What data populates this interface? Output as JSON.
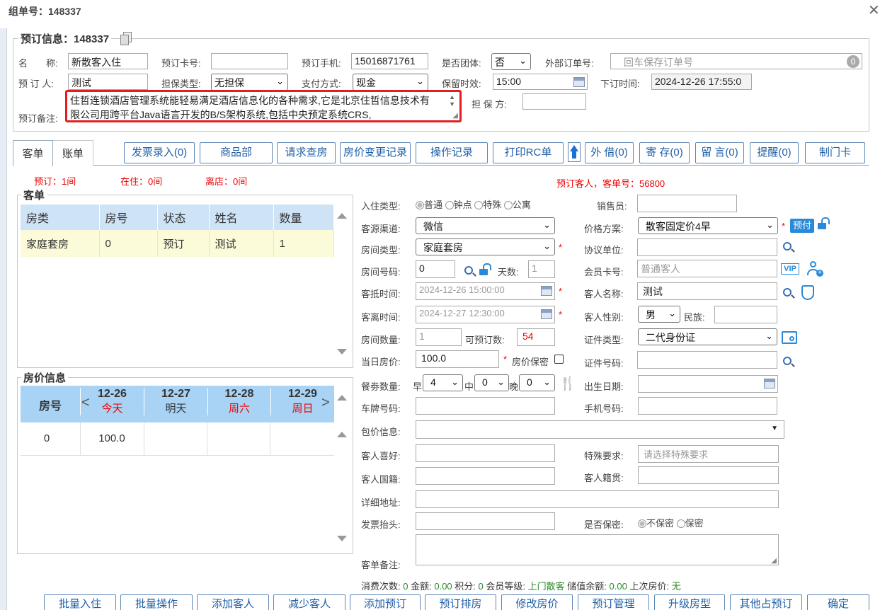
{
  "window": {
    "title": "组单号：148337"
  },
  "booking": {
    "legend": "预订信息：148337",
    "name_label": "名　　称:",
    "name_value": "新散客入住",
    "card_label": "预订卡号:",
    "card_value": "",
    "phone_label": "预订手机:",
    "phone_value": "15016871761",
    "group_label": "是否团体:",
    "group_value": "否",
    "external_label": "外部订单号:",
    "external_placeholder": "回车保存订单号",
    "external_badge": "0",
    "booker_label": "预 订 人:",
    "booker_value": "测试",
    "guarantee_type_label": "担保类型:",
    "guarantee_type_value": "无担保",
    "pay_label": "支付方式:",
    "pay_value": "现金",
    "retain_label": "保留时效:",
    "retain_value": "15:00",
    "order_time_label": "下订时间:",
    "order_time_value": "2024-12-26 17:55:0",
    "remark_label": "预订备注:",
    "remark_value": "住哲连锁酒店管理系统能轻易满足酒店信息化的各种需求,它是北京住哲信息技术有限公司用跨平台Java语言开发的B/S架构系统,包括中央预定系统CRS,",
    "guarantor_label": "担 保 方:",
    "guarantor_value": ""
  },
  "tabs": [
    "客单",
    "账单"
  ],
  "toolbar": {
    "invoice": "发票录入(0)",
    "goods": "商品部",
    "housekeeping": "请求查房",
    "price_log": "房价变更记录",
    "op_log": "操作记录",
    "print_rc": "打印RC单",
    "borrow": "外 借(0)",
    "deposit": "寄 存(0)",
    "message": "留 言(0)",
    "reminder": "提醒(0)",
    "make_card": "制门卡"
  },
  "status": {
    "reserved": "预订：1间",
    "in_house": "在住：0间",
    "departed": "离店：0间",
    "guest_info": "预订客人，客单号：56800"
  },
  "guest_list": {
    "legend": "客单",
    "columns": [
      "房类",
      "房号",
      "状态",
      "姓名",
      "数量"
    ],
    "rows": [
      [
        "家庭套房",
        "0",
        "预订",
        "测试",
        "1"
      ]
    ]
  },
  "price_info": {
    "legend": "房价信息",
    "room_col": "房号",
    "dates": [
      {
        "d": "12-26",
        "w": "今天"
      },
      {
        "d": "12-27",
        "w": "明天"
      },
      {
        "d": "12-28",
        "w": "周六"
      },
      {
        "d": "12-29",
        "w": "周日"
      }
    ],
    "row": {
      "room": "0",
      "p1": "100.0"
    }
  },
  "form": {
    "checkin_type_label": "入住类型:",
    "checkin_types": [
      "普通",
      "钟点",
      "特殊",
      "公寓"
    ],
    "sales_label": "销售员:",
    "source_label": "客源渠道:",
    "source_value": "微信",
    "price_plan_label": "价格方案:",
    "price_plan_value": "散客固定价4早",
    "prepay": "预付",
    "room_type_label": "房间类型:",
    "room_type_value": "家庭套房",
    "agreement_label": "协议单位:",
    "room_no_label": "房间号码:",
    "room_no_value": "0",
    "days_label": "天数:",
    "days_value": "1",
    "member_label": "会员卡号:",
    "member_placeholder": "普通客人",
    "vip": "VIP",
    "arrive_label": "客抵时间:",
    "arrive_value": "2024-12-26 15:00:00",
    "guest_name_label": "客人名称:",
    "guest_name_value": "测试",
    "depart_label": "客离时间:",
    "depart_value": "2024-12-27 12:30:00",
    "gender_label": "客人性别:",
    "gender_value": "男",
    "ethnic_label": "民族:",
    "room_count_label": "房间数量:",
    "room_count_value": "1",
    "avail_label": "可预订数:",
    "avail_value": "54",
    "id_type_label": "证件类型:",
    "id_type_value": "二代身份证",
    "day_price_label": "当日房价:",
    "day_price_value": "100.0",
    "price_secret_label": "房价保密",
    "id_no_label": "证件号码:",
    "meal_label": "餐劵数量:",
    "breakfast_label": "早",
    "breakfast_value": "4",
    "lunch_label": "中",
    "lunch_value": "0",
    "dinner_label": "晚",
    "dinner_value": "0",
    "birth_label": "出生日期:",
    "plate_label": "车牌号码:",
    "mobile_label": "手机号码:",
    "package_label": "包价信息:",
    "hobby_label": "客人喜好:",
    "special_label": "特殊要求:",
    "special_placeholder": "请选择特殊要求",
    "nationality_label": "客人国籍:",
    "native_label": "客人籍贯:",
    "address_label": "详细地址:",
    "invoice_title_label": "发票抬头:",
    "secret_label": "是否保密:",
    "secret_options": [
      "不保密",
      "保密"
    ],
    "guest_remark_label": "客单备注:"
  },
  "summary": {
    "consume_label": "消费次数:",
    "consume": "0",
    "amount_label": "金额:",
    "amount": "0.00",
    "points_label": "积分:",
    "points": "0",
    "level_label": "会员等级:",
    "level": "上门散客",
    "balance_label": "储值余额:",
    "balance": "0.00",
    "last_price_label": "上次房价:",
    "last_price": "无"
  },
  "bottom_buttons": [
    "批量入住",
    "批量操作",
    "添加客人",
    "减少客人",
    "添加预订",
    "预订排房",
    "修改房价",
    "预订管理",
    "升级房型",
    "其他占预订",
    "确定"
  ]
}
